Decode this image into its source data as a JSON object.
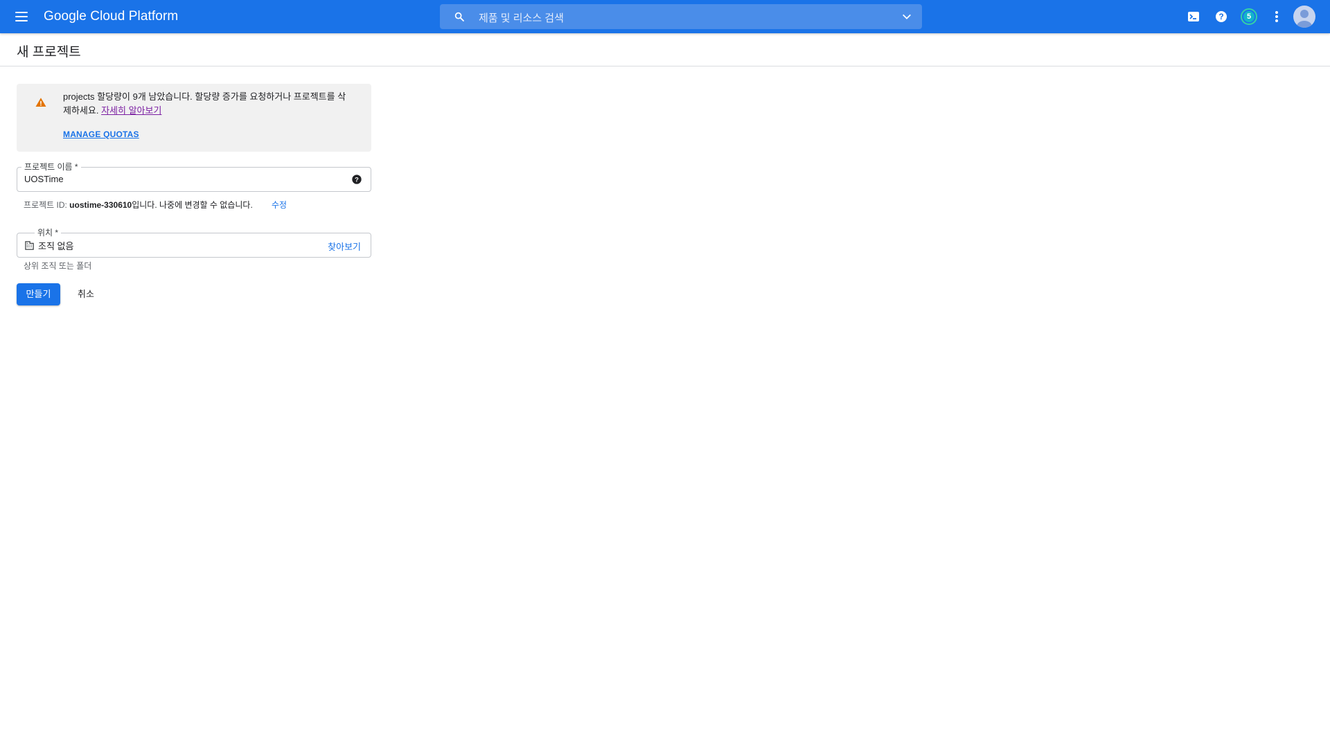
{
  "topbar": {
    "brand": "Google Cloud Platform",
    "search_placeholder": "제품 및 리소스 검색",
    "notification_count": "5"
  },
  "page": {
    "title": "새 프로젝트"
  },
  "warning": {
    "text": "projects 할당량이 9개 남았습니다. 할당량 증가를 요청하거나 프로젝트를 삭제하세요.",
    "learn_more": "자세히 알아보기",
    "manage_quotas": "MANAGE QUOTAS"
  },
  "project_name": {
    "label": "프로젝트 이름 *",
    "value": "UOSTime"
  },
  "project_id": {
    "prefix": "프로젝트 ID: ",
    "id": "uostime-330610",
    "suffix": "입니다. 나중에 변경할 수 없습니다.",
    "edit": "수정"
  },
  "location": {
    "label": "위치 *",
    "value": "조직 없음",
    "browse": "찾아보기",
    "hint": "상위 조직 또는 폴더"
  },
  "actions": {
    "create": "만들기",
    "cancel": "취소"
  },
  "colors": {
    "primary": "#1a73e8",
    "warning": "#e37400",
    "link_visited": "#7b1fa2"
  }
}
